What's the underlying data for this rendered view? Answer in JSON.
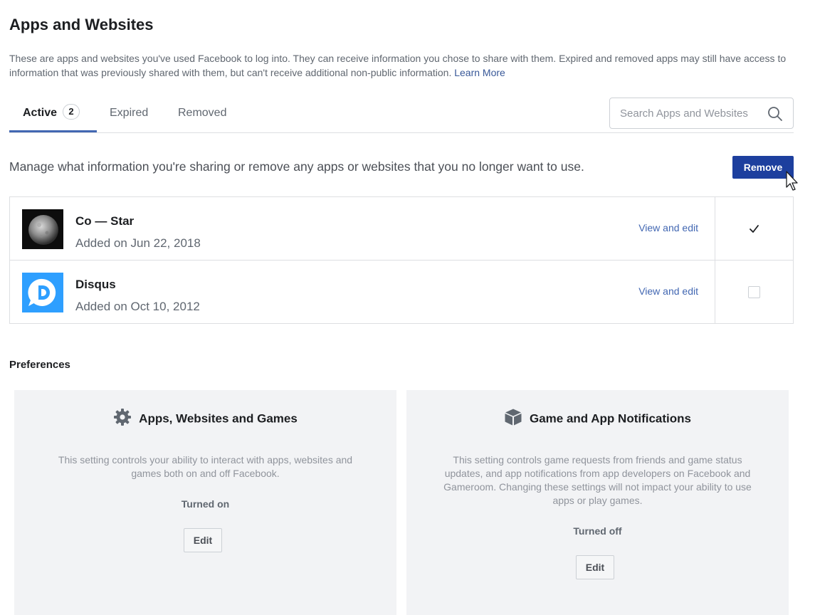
{
  "page": {
    "title": "Apps and Websites",
    "intro": "These are apps and websites you've used Facebook to log into. They can receive information you chose to share with them. Expired and removed apps may still have access to information that was previously shared with them, but can't receive additional non-public information.",
    "learn_more": "Learn More"
  },
  "tabs": {
    "active": {
      "label": "Active",
      "count": "2"
    },
    "expired": {
      "label": "Expired"
    },
    "removed": {
      "label": "Removed"
    }
  },
  "search": {
    "placeholder": "Search Apps and Websites"
  },
  "manage": {
    "text": "Manage what information you're sharing or remove any apps or websites that you no longer want to use.",
    "remove_label": "Remove"
  },
  "apps": [
    {
      "name": "Co — Star",
      "added": "Added on Jun 22, 2018",
      "link": "View and edit",
      "checked": true,
      "icon": "moon-icon"
    },
    {
      "name": "Disqus",
      "added": "Added on Oct 10, 2012",
      "link": "View and edit",
      "checked": false,
      "icon": "disqus-logo-icon"
    }
  ],
  "preferences": {
    "title": "Preferences",
    "cards": [
      {
        "title": "Apps, Websites and Games",
        "icon": "gear-icon",
        "description": "This setting controls your ability to interact with apps, websites and games both on and off Facebook.",
        "status": "Turned on",
        "edit_label": "Edit"
      },
      {
        "title": "Game and App Notifications",
        "icon": "cube-icon",
        "description": "This setting controls game requests from friends and game status updates, and app notifications from app developers on Facebook and Gameroom. Changing these settings will not impact your ability to use apps or play games.",
        "status": "Turned off",
        "edit_label": "Edit"
      }
    ]
  },
  "colors": {
    "accent": "#4267b2",
    "remove_button": "#1d3f9e",
    "card_background": "#f2f3f5"
  }
}
